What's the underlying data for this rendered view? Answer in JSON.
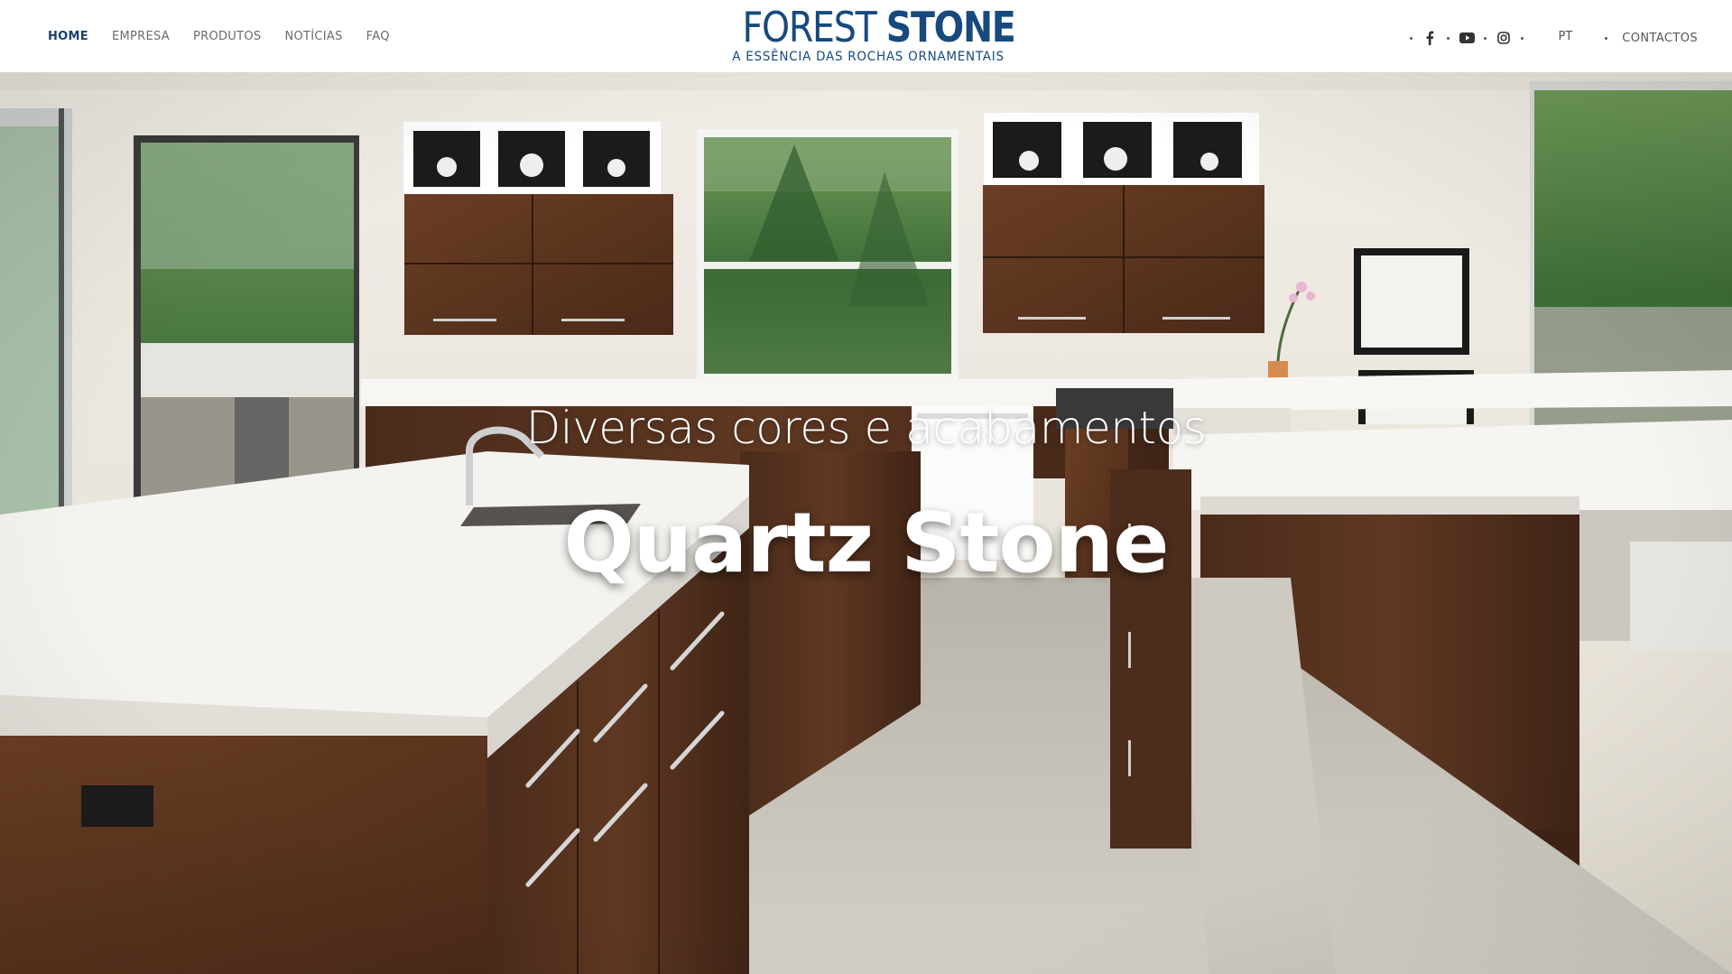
{
  "nav": {
    "items": [
      {
        "label": "HOME",
        "active": true
      },
      {
        "label": "EMPRESA",
        "active": false
      },
      {
        "label": "PRODUTOS",
        "active": false
      },
      {
        "label": "NOTÍCIAS",
        "active": false
      },
      {
        "label": "FAQ",
        "active": false
      }
    ]
  },
  "logo": {
    "word1": "FOREST",
    "word2": "STONE",
    "tagline": "A ESSÊNCIA DAS ROCHAS ORNAMENTAIS"
  },
  "header_right": {
    "social": [
      "facebook-icon",
      "youtube-icon",
      "instagram-icon"
    ],
    "language": "PT",
    "contact": "CONTACTOS"
  },
  "hero": {
    "subtitle": "Diversas cores e acabamentos",
    "title": "Quartz Stone",
    "image": "modern-kitchen-photo"
  },
  "colors": {
    "brand": "#164a7e",
    "nav_active": "#1b3f6e",
    "nav_text": "#6b6b6b"
  }
}
